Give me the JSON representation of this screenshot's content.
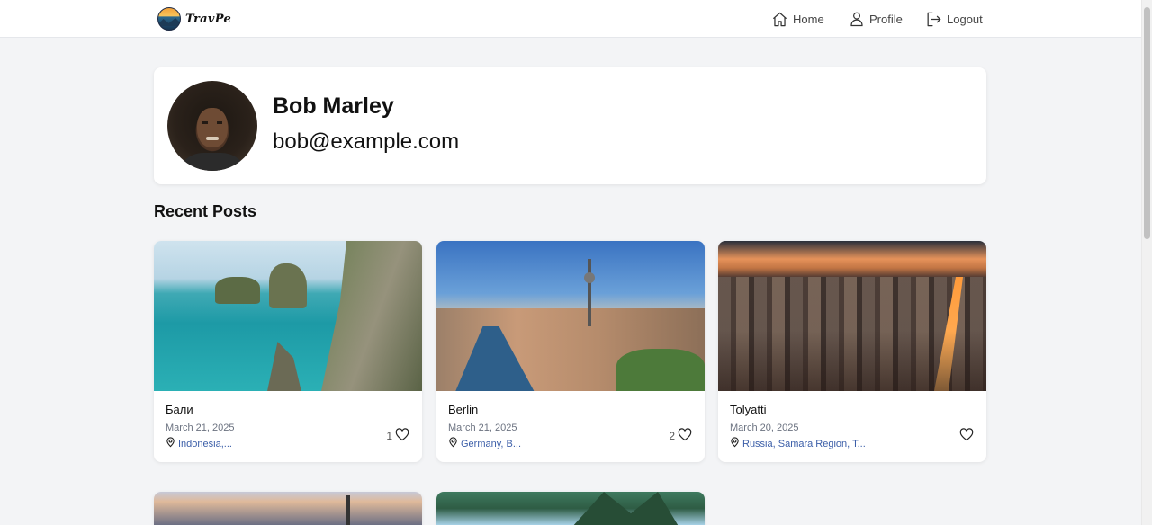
{
  "navbar": {
    "logo_text": "TravPe",
    "home_label": "Home",
    "profile_label": "Profile",
    "logout_label": "Logout"
  },
  "profile": {
    "name": "Bob Marley",
    "email": "bob@example.com"
  },
  "section_title": "Recent Posts",
  "posts": [
    {
      "title": "Бали",
      "date": "March 21, 2025",
      "location": "Indonesia,...",
      "likes": "1"
    },
    {
      "title": "Berlin",
      "date": "March 21, 2025",
      "location": "Germany, B...",
      "likes": "2"
    },
    {
      "title": "Tolyatti",
      "date": "March 20, 2025",
      "location": "Russia, Samara Region, T...",
      "likes": ""
    }
  ],
  "colors": {
    "background": "#f3f4f6",
    "card": "#ffffff",
    "location_link": "#3b5ea8",
    "muted_text": "#6b7280"
  },
  "icons": [
    "home-icon",
    "user-icon",
    "logout-icon",
    "map-pin-icon",
    "heart-icon"
  ]
}
